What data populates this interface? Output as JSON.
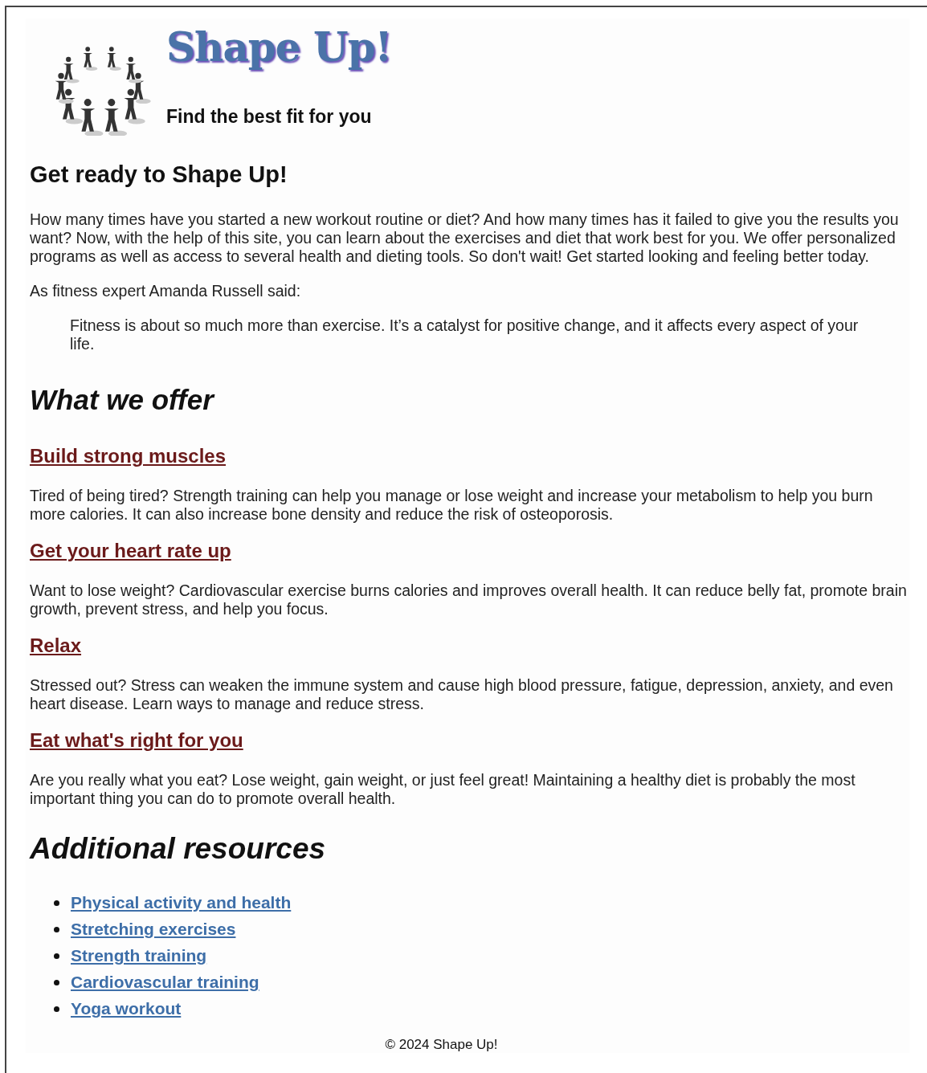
{
  "header": {
    "title": "Shape Up!",
    "tagline": "Find the best fit for you"
  },
  "intro": {
    "heading": "Get ready to Shape Up!",
    "paragraphs": [
      "How many times have you started a new workout routine or diet? And how many times has it failed to give you the results you want? Now, with the help of this site, you can learn about the exercises and diet that work best for you. We offer personalized programs as well as access to several health and dieting tools. So don't wait! Get started looking and feeling better today.",
      "As fitness expert Amanda Russell said:"
    ],
    "quote": "Fitness is about so much more than exercise. It’s a catalyst for positive change, and it affects every aspect of your life."
  },
  "offer": {
    "heading": "What we offer",
    "items": [
      {
        "title": "Build strong muscles",
        "text": "Tired of being tired? Strength training can help you manage or lose weight and increase your metabolism to help you burn more calories. It can also increase bone density and reduce the risk of osteoporosis."
      },
      {
        "title": "Get your heart rate up",
        "text": "Want to lose weight? Cardiovascular exercise burns calories and improves overall health. It can reduce belly fat, promote brain growth, prevent stress, and help you focus."
      },
      {
        "title": "Relax",
        "text": "Stressed out? Stress can weaken the immune system and cause high blood pressure, fatigue, depression, anxiety, and even heart disease. Learn ways to manage and reduce stress."
      },
      {
        "title": "Eat what's right for you",
        "text": "Are you really what you eat? Lose weight, gain weight, or just feel great! Maintaining a healthy diet is probably the most important thing you can do to promote overall health."
      }
    ]
  },
  "resources": {
    "heading": "Additional resources",
    "links": [
      "Physical activity and health",
      "Stretching exercises",
      "Strength training",
      "Cardiovascular training",
      "Yoga workout"
    ]
  },
  "footer": "© 2024 Shape Up!"
}
